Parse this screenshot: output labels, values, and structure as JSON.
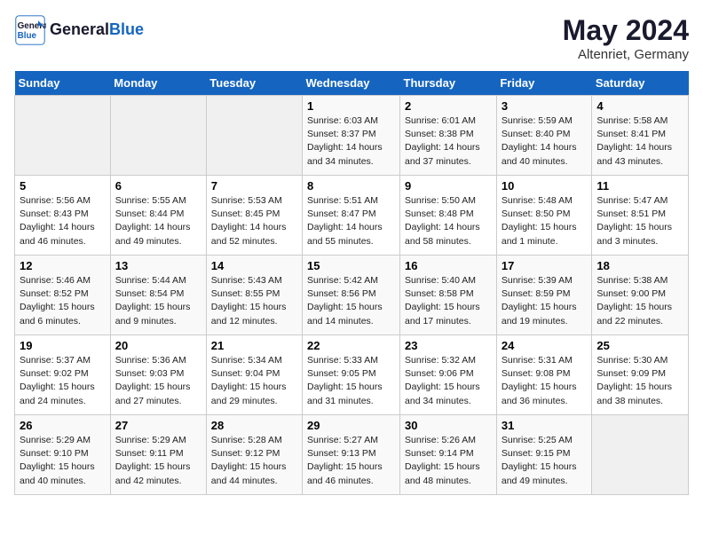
{
  "header": {
    "logo_line1": "General",
    "logo_line2": "Blue",
    "month_year": "May 2024",
    "location": "Altenriet, Germany"
  },
  "days_of_week": [
    "Sunday",
    "Monday",
    "Tuesday",
    "Wednesday",
    "Thursday",
    "Friday",
    "Saturday"
  ],
  "weeks": [
    [
      {
        "day": "",
        "info": ""
      },
      {
        "day": "",
        "info": ""
      },
      {
        "day": "",
        "info": ""
      },
      {
        "day": "1",
        "info": "Sunrise: 6:03 AM\nSunset: 8:37 PM\nDaylight: 14 hours\nand 34 minutes."
      },
      {
        "day": "2",
        "info": "Sunrise: 6:01 AM\nSunset: 8:38 PM\nDaylight: 14 hours\nand 37 minutes."
      },
      {
        "day": "3",
        "info": "Sunrise: 5:59 AM\nSunset: 8:40 PM\nDaylight: 14 hours\nand 40 minutes."
      },
      {
        "day": "4",
        "info": "Sunrise: 5:58 AM\nSunset: 8:41 PM\nDaylight: 14 hours\nand 43 minutes."
      }
    ],
    [
      {
        "day": "5",
        "info": "Sunrise: 5:56 AM\nSunset: 8:43 PM\nDaylight: 14 hours\nand 46 minutes."
      },
      {
        "day": "6",
        "info": "Sunrise: 5:55 AM\nSunset: 8:44 PM\nDaylight: 14 hours\nand 49 minutes."
      },
      {
        "day": "7",
        "info": "Sunrise: 5:53 AM\nSunset: 8:45 PM\nDaylight: 14 hours\nand 52 minutes."
      },
      {
        "day": "8",
        "info": "Sunrise: 5:51 AM\nSunset: 8:47 PM\nDaylight: 14 hours\nand 55 minutes."
      },
      {
        "day": "9",
        "info": "Sunrise: 5:50 AM\nSunset: 8:48 PM\nDaylight: 14 hours\nand 58 minutes."
      },
      {
        "day": "10",
        "info": "Sunrise: 5:48 AM\nSunset: 8:50 PM\nDaylight: 15 hours\nand 1 minute."
      },
      {
        "day": "11",
        "info": "Sunrise: 5:47 AM\nSunset: 8:51 PM\nDaylight: 15 hours\nand 3 minutes."
      }
    ],
    [
      {
        "day": "12",
        "info": "Sunrise: 5:46 AM\nSunset: 8:52 PM\nDaylight: 15 hours\nand 6 minutes."
      },
      {
        "day": "13",
        "info": "Sunrise: 5:44 AM\nSunset: 8:54 PM\nDaylight: 15 hours\nand 9 minutes."
      },
      {
        "day": "14",
        "info": "Sunrise: 5:43 AM\nSunset: 8:55 PM\nDaylight: 15 hours\nand 12 minutes."
      },
      {
        "day": "15",
        "info": "Sunrise: 5:42 AM\nSunset: 8:56 PM\nDaylight: 15 hours\nand 14 minutes."
      },
      {
        "day": "16",
        "info": "Sunrise: 5:40 AM\nSunset: 8:58 PM\nDaylight: 15 hours\nand 17 minutes."
      },
      {
        "day": "17",
        "info": "Sunrise: 5:39 AM\nSunset: 8:59 PM\nDaylight: 15 hours\nand 19 minutes."
      },
      {
        "day": "18",
        "info": "Sunrise: 5:38 AM\nSunset: 9:00 PM\nDaylight: 15 hours\nand 22 minutes."
      }
    ],
    [
      {
        "day": "19",
        "info": "Sunrise: 5:37 AM\nSunset: 9:02 PM\nDaylight: 15 hours\nand 24 minutes."
      },
      {
        "day": "20",
        "info": "Sunrise: 5:36 AM\nSunset: 9:03 PM\nDaylight: 15 hours\nand 27 minutes."
      },
      {
        "day": "21",
        "info": "Sunrise: 5:34 AM\nSunset: 9:04 PM\nDaylight: 15 hours\nand 29 minutes."
      },
      {
        "day": "22",
        "info": "Sunrise: 5:33 AM\nSunset: 9:05 PM\nDaylight: 15 hours\nand 31 minutes."
      },
      {
        "day": "23",
        "info": "Sunrise: 5:32 AM\nSunset: 9:06 PM\nDaylight: 15 hours\nand 34 minutes."
      },
      {
        "day": "24",
        "info": "Sunrise: 5:31 AM\nSunset: 9:08 PM\nDaylight: 15 hours\nand 36 minutes."
      },
      {
        "day": "25",
        "info": "Sunrise: 5:30 AM\nSunset: 9:09 PM\nDaylight: 15 hours\nand 38 minutes."
      }
    ],
    [
      {
        "day": "26",
        "info": "Sunrise: 5:29 AM\nSunset: 9:10 PM\nDaylight: 15 hours\nand 40 minutes."
      },
      {
        "day": "27",
        "info": "Sunrise: 5:29 AM\nSunset: 9:11 PM\nDaylight: 15 hours\nand 42 minutes."
      },
      {
        "day": "28",
        "info": "Sunrise: 5:28 AM\nSunset: 9:12 PM\nDaylight: 15 hours\nand 44 minutes."
      },
      {
        "day": "29",
        "info": "Sunrise: 5:27 AM\nSunset: 9:13 PM\nDaylight: 15 hours\nand 46 minutes."
      },
      {
        "day": "30",
        "info": "Sunrise: 5:26 AM\nSunset: 9:14 PM\nDaylight: 15 hours\nand 48 minutes."
      },
      {
        "day": "31",
        "info": "Sunrise: 5:25 AM\nSunset: 9:15 PM\nDaylight: 15 hours\nand 49 minutes."
      },
      {
        "day": "",
        "info": ""
      }
    ]
  ]
}
